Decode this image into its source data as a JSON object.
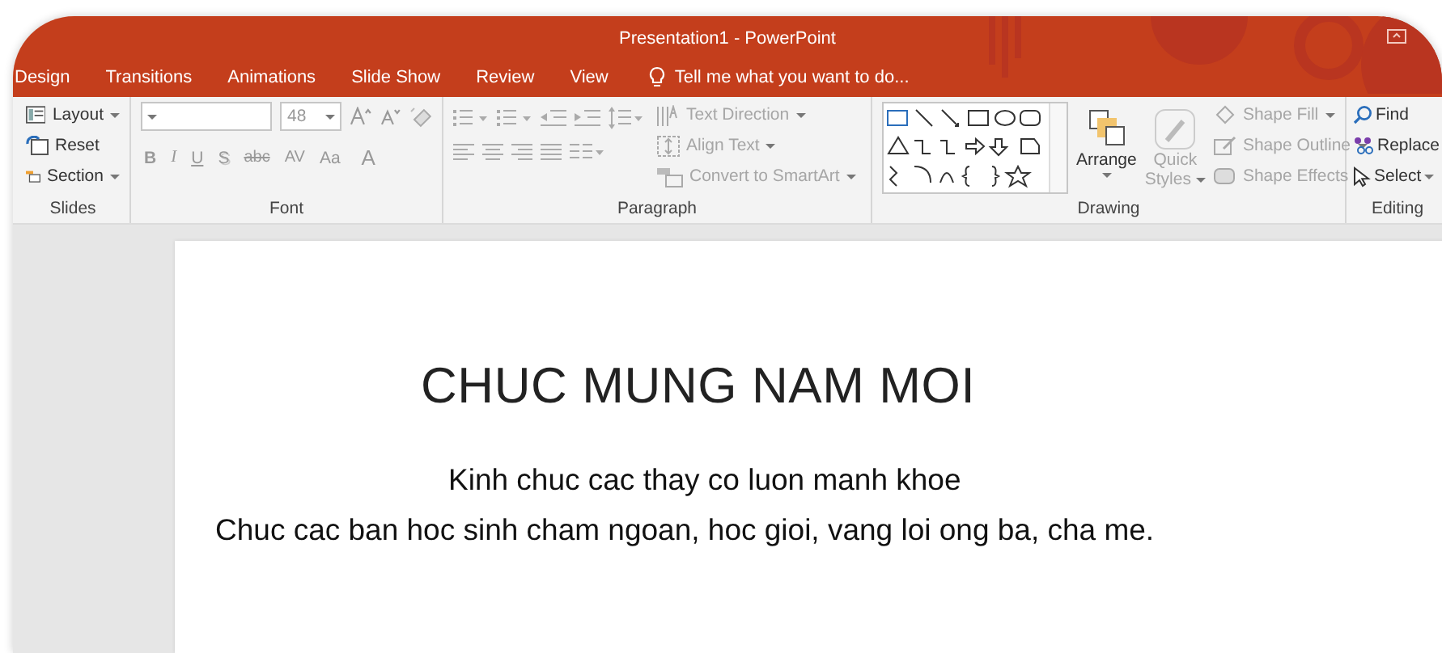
{
  "window": {
    "title": "Presentation1 - PowerPoint"
  },
  "tabs": [
    {
      "label": "Design"
    },
    {
      "label": "Transitions"
    },
    {
      "label": "Animations"
    },
    {
      "label": "Slide Show"
    },
    {
      "label": "Review"
    },
    {
      "label": "View"
    }
  ],
  "tell_me": {
    "placeholder": "Tell me what you want to do..."
  },
  "ribbon": {
    "slides": {
      "label": "Slides",
      "items": [
        {
          "label": "Layout",
          "has_menu": true
        },
        {
          "label": "Reset",
          "has_menu": false
        },
        {
          "label": "Section",
          "has_menu": true
        }
      ]
    },
    "font": {
      "label": "Font",
      "font_size": "48",
      "format_buttons": [
        {
          "label": "B",
          "kind": "bold",
          "disabled": true
        },
        {
          "label": "I",
          "kind": "italic",
          "disabled": true
        },
        {
          "label": "U",
          "kind": "underline",
          "disabled": true
        },
        {
          "label": "S",
          "kind": "shadow",
          "disabled": true
        },
        {
          "label": "abc",
          "kind": "strike",
          "disabled": true
        },
        {
          "label": "AV",
          "kind": "spacing",
          "disabled": true
        },
        {
          "label": "Aa",
          "kind": "case",
          "disabled": true
        },
        {
          "label": "A",
          "kind": "color",
          "disabled": true
        }
      ]
    },
    "paragraph": {
      "label": "Paragraph",
      "commands": [
        {
          "label": "Text Direction",
          "disabled": true
        },
        {
          "label": "Align Text",
          "disabled": true
        },
        {
          "label": "Convert to SmartArt",
          "disabled": true
        }
      ]
    },
    "drawing": {
      "label": "Drawing",
      "arrange": {
        "label": "Arrange"
      },
      "quick_styles": {
        "label_1": "Quick",
        "label_2": "Styles",
        "disabled": true
      },
      "commands": [
        {
          "label": "Shape Fill",
          "disabled": true
        },
        {
          "label": "Shape Outline",
          "disabled": true
        },
        {
          "label": "Shape Effects",
          "disabled": true
        }
      ]
    },
    "editing": {
      "label": "Editing",
      "commands": [
        {
          "label": "Find",
          "has_menu": false
        },
        {
          "label": "Replace",
          "has_menu": false
        },
        {
          "label": "Select",
          "has_menu": true
        }
      ]
    }
  },
  "slide": {
    "title": "CHUC MUNG NAM MOI",
    "lines": [
      "Kinh chuc cac thay co luon manh khoe",
      "Chuc cac ban hoc sinh cham ngoan, hoc gioi, vang loi ong ba, cha me."
    ]
  }
}
